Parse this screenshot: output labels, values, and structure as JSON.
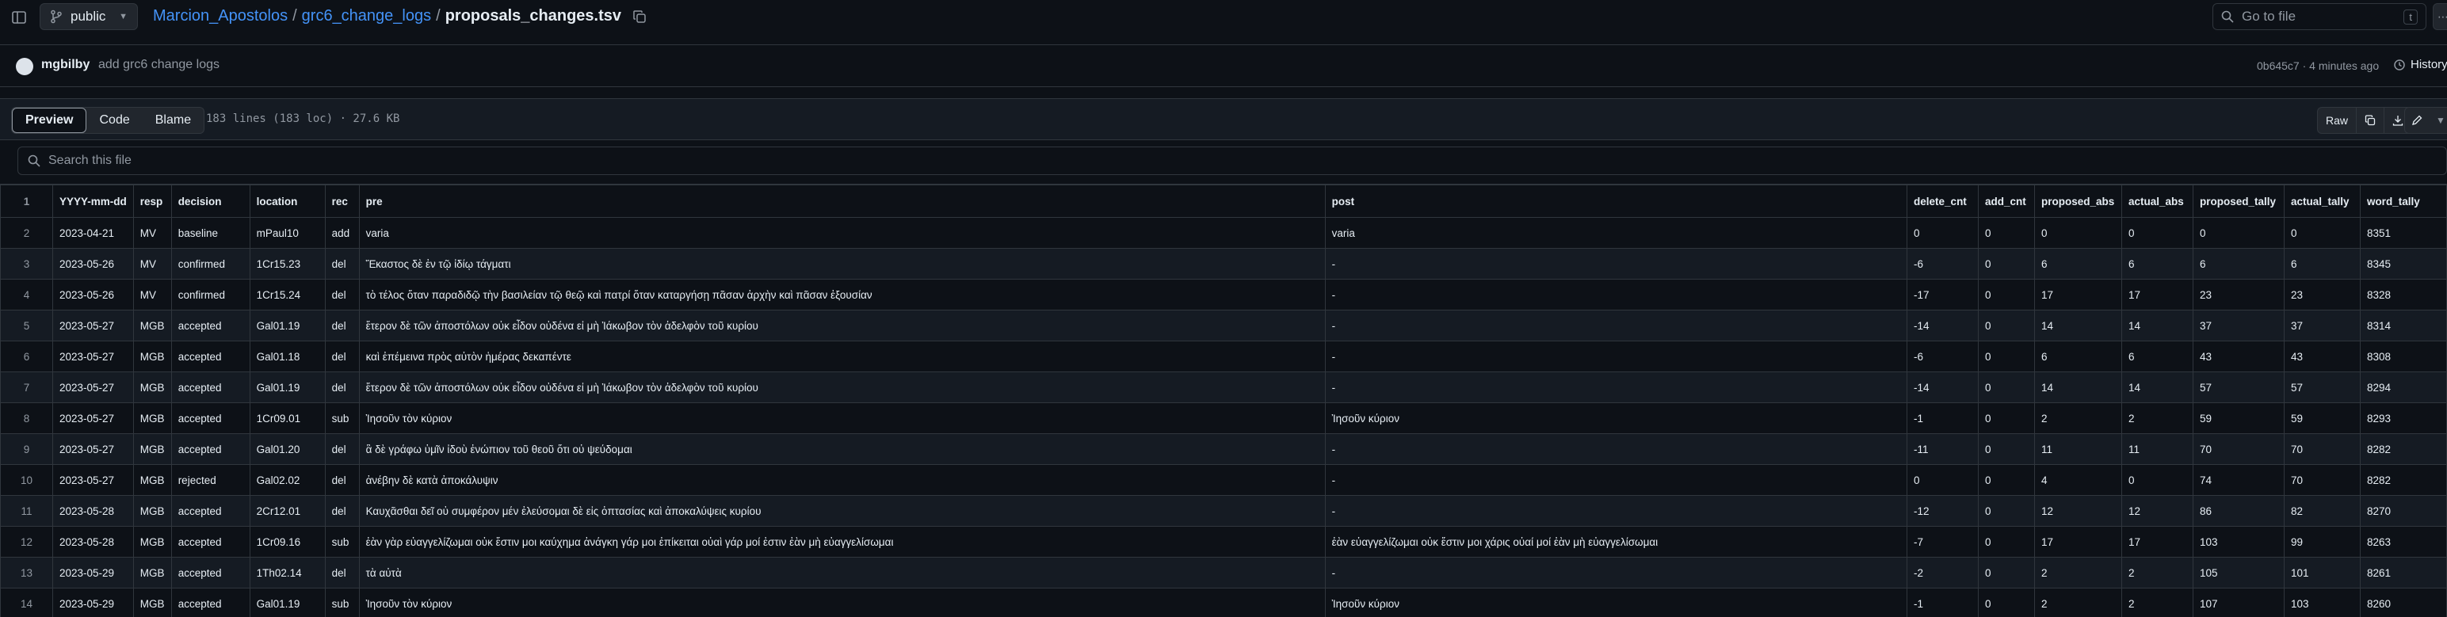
{
  "header": {
    "visibility": "public",
    "breadcrumb": {
      "owner": "Marcion_Apostolos",
      "folder": "grc6_change_logs",
      "file": "proposals_changes.tsv"
    },
    "goto_placeholder": "Go to file",
    "goto_shortcut": "t"
  },
  "commit": {
    "author": "mgbilby",
    "message": "add grc6 change logs",
    "meta": "0b645c7 · 4 minutes ago",
    "history_label": "History"
  },
  "file": {
    "tabs": [
      "Preview",
      "Code",
      "Blame"
    ],
    "active_tab": "Preview",
    "info": "183 lines (183 loc) · 27.6 KB",
    "raw_label": "Raw"
  },
  "search": {
    "placeholder": "Search this file"
  },
  "table": {
    "headers": [
      "YYYY-mm-dd",
      "resp",
      "decision",
      "location",
      "rec",
      "pre",
      "post",
      "delete_cnt",
      "add_cnt",
      "proposed_abs",
      "actual_abs",
      "proposed_tally",
      "actual_tally",
      "word_tally"
    ],
    "rows": [
      [
        "2",
        "2023-04-21",
        "MV",
        "baseline",
        "mPaul10",
        "add",
        "varia",
        "varia",
        "0",
        "0",
        "0",
        "0",
        "0",
        "0",
        "8351"
      ],
      [
        "3",
        "2023-05-26",
        "MV",
        "confirmed",
        "1Cr15.23",
        "del",
        "Ἕκαστος δὲ ἐν τῷ ἰδίῳ τάγματι",
        "-",
        "-6",
        "0",
        "6",
        "6",
        "6",
        "6",
        "8345"
      ],
      [
        "4",
        "2023-05-26",
        "MV",
        "confirmed",
        "1Cr15.24",
        "del",
        "τὸ τέλος ὅταν παραδιδῷ τὴν βασιλείαν τῷ θεῷ καὶ πατρί ὅταν καταργήσῃ πᾶσαν ἀρχὴν καὶ πᾶσαν ἐξουσίαν",
        "-",
        "-17",
        "0",
        "17",
        "17",
        "23",
        "23",
        "8328"
      ],
      [
        "5",
        "2023-05-27",
        "MGB",
        "accepted",
        "Gal01.19",
        "del",
        "ἕτερον δὲ τῶν ἀποστόλων οὐκ εἶδον οὐδένα εἰ μὴ Ἰάκωβον τὸν ἀδελφὸν τοῦ κυρίου",
        "-",
        "-14",
        "0",
        "14",
        "14",
        "37",
        "37",
        "8314"
      ],
      [
        "6",
        "2023-05-27",
        "MGB",
        "accepted",
        "Gal01.18",
        "del",
        "καὶ ἐπέμεινα πρὸς αὐτὸν ἡμέρας δεκαπέντε",
        "-",
        "-6",
        "0",
        "6",
        "6",
        "43",
        "43",
        "8308"
      ],
      [
        "7",
        "2023-05-27",
        "MGB",
        "accepted",
        "Gal01.19",
        "del",
        "ἕτερον δὲ τῶν ἀποστόλων οὐκ εἶδον οὐδένα εἰ μὴ Ἰάκωβον τὸν ἀδελφὸν τοῦ κυρίου",
        "-",
        "-14",
        "0",
        "14",
        "14",
        "57",
        "57",
        "8294"
      ],
      [
        "8",
        "2023-05-27",
        "MGB",
        "accepted",
        "1Cr09.01",
        "sub",
        "Ἰησοῦν τὸν κύριον",
        "Ἰησοῦν κύριον",
        "-1",
        "0",
        "2",
        "2",
        "59",
        "59",
        "8293"
      ],
      [
        "9",
        "2023-05-27",
        "MGB",
        "accepted",
        "Gal01.20",
        "del",
        "ἃ δὲ γράφω ὑμῖν ἰδοὺ ἐνώπιον τοῦ θεοῦ ὅτι οὐ ψεύδομαι",
        "-",
        "-11",
        "0",
        "11",
        "11",
        "70",
        "70",
        "8282"
      ],
      [
        "10",
        "2023-05-27",
        "MGB",
        "rejected",
        "Gal02.02",
        "del",
        "ἀνέβην δὲ κατὰ ἀποκάλυψιν",
        "-",
        "0",
        "0",
        "4",
        "0",
        "74",
        "70",
        "8282"
      ],
      [
        "11",
        "2023-05-28",
        "MGB",
        "accepted",
        "2Cr12.01",
        "del",
        "Καυχᾶσθαι δεῖ οὐ συμφέρον μέν ἐλεύσομαι δὲ εἰς ὀπτασίας καὶ ἀποκαλύψεις κυρίου",
        "-",
        "-12",
        "0",
        "12",
        "12",
        "86",
        "82",
        "8270"
      ],
      [
        "12",
        "2023-05-28",
        "MGB",
        "accepted",
        "1Cr09.16",
        "sub",
        "ἐὰν γὰρ εὐαγγελίζωμαι οὐκ ἔστιν μοι καύχημα ἀνάγκη γάρ μοι ἐπίκειται οὐαὶ γάρ μοί ἐστιν ἐὰν μὴ εὐαγγελίσωμαι",
        "ἐὰν εὐαγγελίζωμαι οὐκ ἔστιν μοι χάρις οὐαί μοί ἐὰν μὴ εὐαγγελίσωμαι",
        "-7",
        "0",
        "17",
        "17",
        "103",
        "99",
        "8263"
      ],
      [
        "13",
        "2023-05-29",
        "MGB",
        "accepted",
        "1Th02.14",
        "del",
        "τὰ αὐτὰ",
        "-",
        "-2",
        "0",
        "2",
        "2",
        "105",
        "101",
        "8261"
      ],
      [
        "14",
        "2023-05-29",
        "MGB",
        "accepted",
        "Gal01.19",
        "sub",
        "Ἰησοῦν τὸν κύριον",
        "Ἰησοῦν κύριον",
        "-1",
        "0",
        "2",
        "2",
        "107",
        "103",
        "8260"
      ]
    ]
  }
}
